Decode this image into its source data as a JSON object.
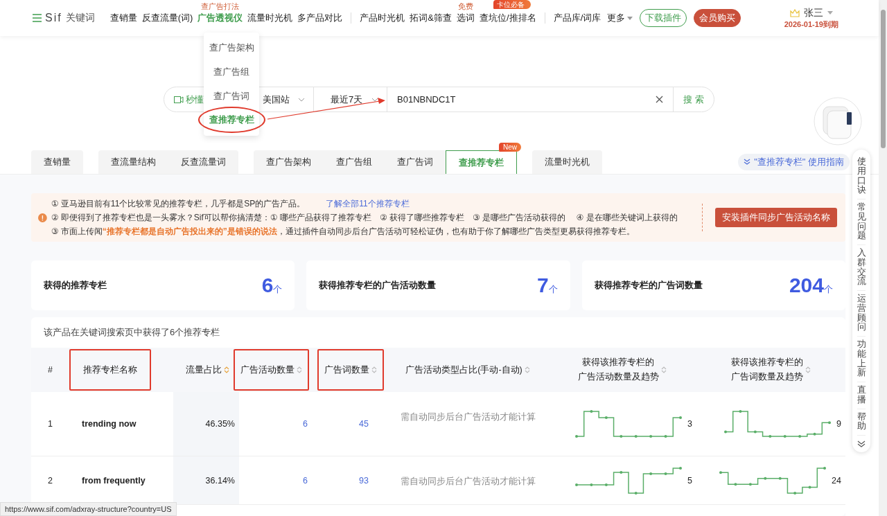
{
  "header": {
    "logo": "Sif",
    "logo_suffix": "关键词",
    "nav_groups": [
      [
        {
          "label": "查销量",
          "selected": false
        },
        {
          "label": "反查流量(词)",
          "selected": false
        },
        {
          "label": "广告透视仪",
          "selected": true,
          "tag": {
            "label": "查广告打法",
            "kind": "text"
          }
        },
        {
          "label": "流量时光机",
          "selected": false
        },
        {
          "label": "多产品对比",
          "selected": false
        }
      ],
      [
        {
          "label": "产品时光机",
          "selected": false
        },
        {
          "label": "拓词&筛查",
          "selected": false
        },
        {
          "label": "选词",
          "selected": false,
          "tag": {
            "label": "免费",
            "kind": "text"
          }
        },
        {
          "label": "查坑位/推排名",
          "selected": false,
          "tag": {
            "label": "卡位必备",
            "kind": "flame"
          }
        }
      ],
      [
        {
          "label": "产品库/词库",
          "selected": false
        }
      ]
    ],
    "more": "更多",
    "buttons": [
      {
        "label": "下载插件",
        "kind": "outline"
      },
      {
        "label": "会员购买",
        "kind": "filled"
      }
    ],
    "user": {
      "name": "张三",
      "expiry": "2026-01-19到期"
    }
  },
  "dropdown": {
    "items": [
      {
        "label": "查广告架构",
        "selected": false,
        "circled": false
      },
      {
        "label": "查广告组",
        "selected": false,
        "circled": false
      },
      {
        "label": "查广告词",
        "selected": false,
        "circled": false
      },
      {
        "label": "查推荐专栏",
        "selected": true,
        "circled": true
      }
    ]
  },
  "search": {
    "video_link": "秒懂",
    "site": "美国站",
    "period": "最近7天",
    "query": "B01NBNDC1T",
    "button": "搜 索"
  },
  "tabs": {
    "groups": [
      [
        {
          "label": "查销量",
          "selected": false
        }
      ],
      [
        {
          "label": "查流量结构",
          "selected": false
        },
        {
          "label": "反查流量词",
          "selected": false
        }
      ],
      [
        {
          "label": "查广告架构",
          "selected": false
        },
        {
          "label": "查广告组",
          "selected": false
        },
        {
          "label": "查广告词",
          "selected": false
        },
        {
          "label": "查推荐专栏",
          "selected": true,
          "badge": "New"
        }
      ],
      [
        {
          "label": "流量时光机",
          "selected": false
        }
      ]
    ],
    "guide": "\"查推荐专栏\" 使用指南"
  },
  "notice": {
    "lines": [
      "① 亚马逊目前有11个比较常见的推荐专栏，几乎都是SP的广告产品。",
      "② 即便得到了推荐专栏也是一头雾水？Sif可以帮你搞清楚：① 哪些产品获得了推荐专栏　② 获得了哪些推荐专栏　③ 是哪些广告活动获得的　 ④ 是在哪些关键词上获得的",
      "③ 市面上传闻**“推荐专栏都是自动广告投出来的”是错误的说法**，通过插件自动同步后台广告活动可轻松证伪，也有助于你了解哪些广告类型更易获得推荐专栏。"
    ],
    "link": "了解全部11个推荐专栏",
    "button": "安装插件同步广告活动名称"
  },
  "stats": [
    {
      "label": "获得的推荐专栏",
      "value": "6",
      "unit": "个"
    },
    {
      "label": "获得推荐专栏的广告活动数量",
      "value": "7",
      "unit": "个"
    },
    {
      "label": "获得推荐专栏的广告词数量",
      "value": "204",
      "unit": "个"
    }
  ],
  "table": {
    "caption": "该产品在关键词搜索页中获得了6个推荐专栏",
    "columns": [
      {
        "lines": [
          "#"
        ],
        "highlighted": false
      },
      {
        "lines": [
          "推荐专栏名称"
        ],
        "highlighted": true
      },
      {
        "lines": [
          "流量占比"
        ],
        "sorted": true,
        "highlighted": false
      },
      {
        "lines": [
          "广告活动数量"
        ],
        "sorted": false,
        "highlighted": true
      },
      {
        "lines": [
          "广告词数量"
        ],
        "sorted": false,
        "highlighted": true
      },
      {
        "lines": [
          "广告活动类型占比(手动-自动)"
        ],
        "sorted": false,
        "highlighted": false
      },
      {
        "lines": [
          "获得该推荐专栏的",
          "广告活动数量及趋势"
        ],
        "sorted": false,
        "highlighted": false
      },
      {
        "lines": [
          "获得该推荐专栏的",
          "广告词数量及趋势"
        ],
        "sorted": false,
        "highlighted": false
      }
    ],
    "rows": [
      {
        "index": "1",
        "name": "trending now",
        "traffic_share": "46.35%",
        "campaigns": "6",
        "keywords": "45",
        "type_ratio": "需自动同步后台广告活动才能计算",
        "campaign_total": "3",
        "keyword_total": "9"
      },
      {
        "index": "2",
        "name": "from frequently",
        "traffic_share": "36.14%",
        "campaigns": "6",
        "keywords": "93",
        "type_ratio": "需自动同步后台广告活动才能计算",
        "campaign_total": "5",
        "keyword_total": "24"
      }
    ]
  },
  "side_panel": {
    "items": [
      "使用口诀",
      "常见问题",
      "入群交流",
      "运营顾问",
      "功能上新",
      "直播",
      "帮助"
    ]
  },
  "status_url": "https://www.sif.com/adxray-structure?country=US"
}
